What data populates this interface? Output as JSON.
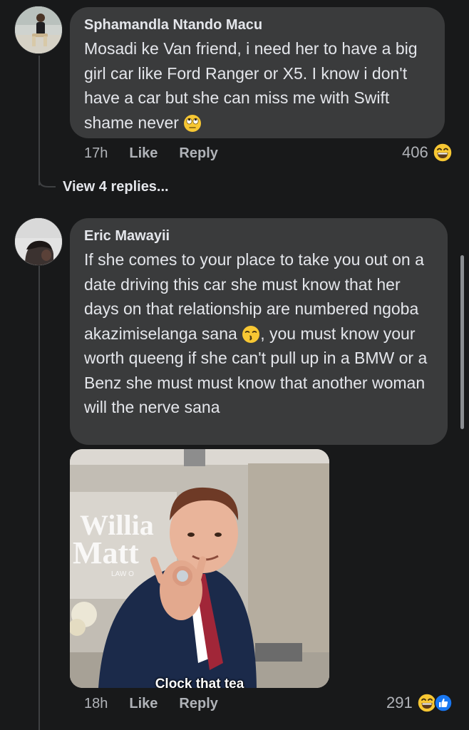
{
  "comments": [
    {
      "author": "Sphamandla Ntando Macu",
      "text": "Mosadi ke Van friend, i need her to have a big girl car like Ford Ranger or X5. I know i don't have a car but she can miss me with Swift shame never",
      "emoji": "eye-roll",
      "time": "17h",
      "like_label": "Like",
      "reply_label": "Reply",
      "reaction_count": "406",
      "reactions": [
        "laughing"
      ]
    },
    {
      "author": "Eric Mawayii",
      "text_before_emoji": "If she comes to your place to take you out on a date driving this car she must know that her days on that relationship are numbered ngoba akazimiselanga sana",
      "text_after_emoji": ", you must know your worth queeng if she can't pull up in a BMW or a Benz she must must know that another woman will the nerve sana",
      "emoji": "kissing-closed-eyes",
      "gif_caption": "Clock that tea",
      "time": "18h",
      "like_label": "Like",
      "reply_label": "Reply",
      "reaction_count": "291",
      "reactions": [
        "laughing",
        "like"
      ]
    }
  ],
  "view_replies_label": "View 4 replies...",
  "colors": {
    "background": "#18191a",
    "bubble": "#3a3b3c",
    "text": "#e4e6eb",
    "meta": "#b0b3b8",
    "like_blue": "#1877f2",
    "emoji_yellow": "#f7c733"
  }
}
